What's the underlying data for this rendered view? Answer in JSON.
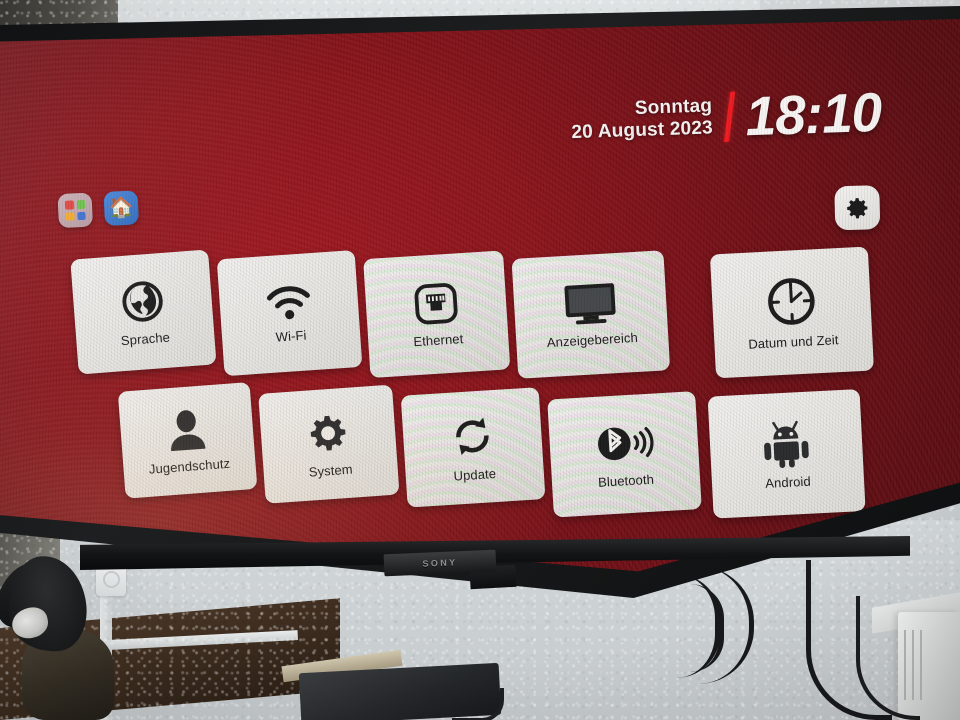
{
  "device": {
    "brand": "SONY",
    "screen_bg_color": "#8a141b",
    "accent_color": "#ef1b22"
  },
  "header": {
    "weekday": "Sonntag",
    "date": "20 August 2023",
    "time": "18:10",
    "divider_color": "#ef1b22"
  },
  "quick_bar": {
    "items": [
      {
        "name": "apps-icon",
        "label": "Apps"
      },
      {
        "name": "home-icon",
        "label": "Home"
      }
    ]
  },
  "settings_button": {
    "icon": "gear-icon",
    "label": "Einstellungen"
  },
  "menu": {
    "rows": 2,
    "columns": 5,
    "tiles": [
      {
        "id": "sprache",
        "label": "Sprache",
        "icon": "globe-icon"
      },
      {
        "id": "wifi",
        "label": "Wi-Fi",
        "icon": "wifi-icon"
      },
      {
        "id": "ethernet",
        "label": "Ethernet",
        "icon": "ethernet-port-icon"
      },
      {
        "id": "anzeigebereich",
        "label": "Anzeigebereich",
        "icon": "monitor-icon"
      },
      {
        "id": "datum-und-zeit",
        "label": "Datum und Zeit",
        "icon": "clock-icon"
      },
      {
        "id": "jugendschutz",
        "label": "Jugendschutz",
        "icon": "person-icon"
      },
      {
        "id": "system",
        "label": "System",
        "icon": "gear-icon"
      },
      {
        "id": "update",
        "label": "Update",
        "icon": "refresh-arrows-icon"
      },
      {
        "id": "bluetooth",
        "label": "Bluetooth",
        "icon": "bluetooth-signal-icon"
      },
      {
        "id": "android",
        "label": "Android",
        "icon": "android-robot-icon"
      }
    ]
  }
}
